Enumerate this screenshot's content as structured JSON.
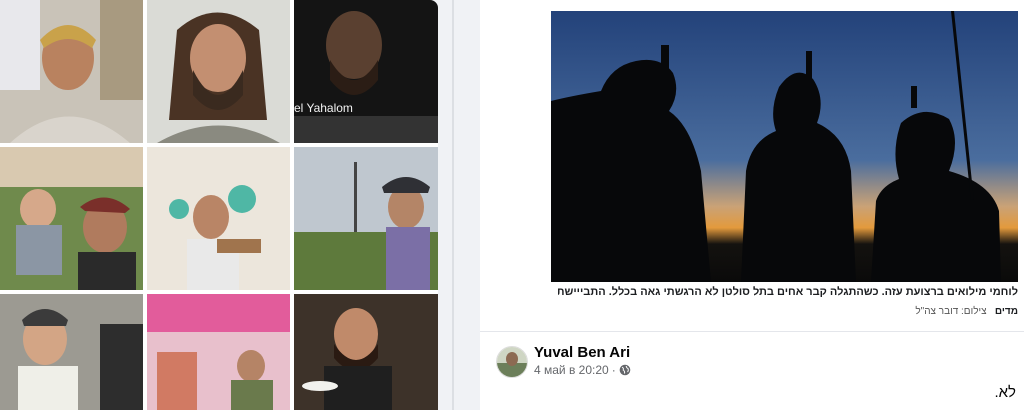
{
  "grid": {
    "overlay_name": "el Yahalom"
  },
  "post": {
    "caption": "לוחמי מילואים ברצועת עזה. כשהתגלה קבר אחים בתל סולטן לא הרגשתי גאה בכלל. התבייישתי לעשות",
    "photo_credit_label": "צילום: דובר צה\"ל",
    "photo_credit_tag": "מדים",
    "author": "Yuval Ben Ari",
    "timestamp": "4 май в 20:20",
    "separator": "·",
    "text_fragment": "לא."
  },
  "colors": {
    "sky_top": "#23427a",
    "sky_horizon": "#e39a3c",
    "text_primary": "#050505",
    "text_secondary": "#65676b"
  },
  "icons": [
    "globe-icon"
  ]
}
